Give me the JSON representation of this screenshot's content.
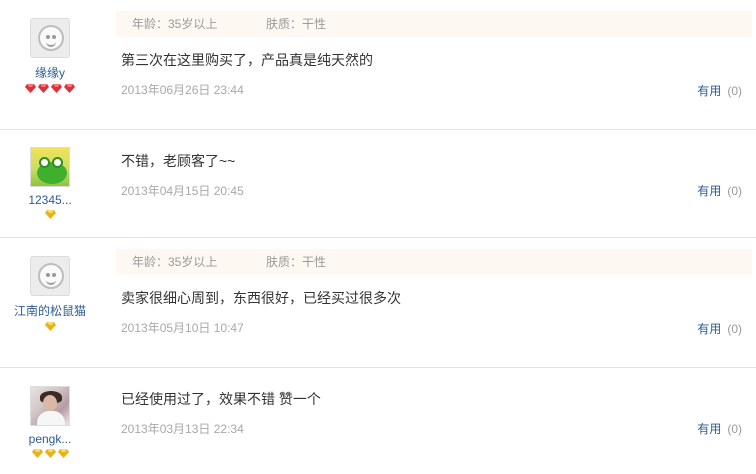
{
  "reviews": [
    {
      "username": "缘缘y",
      "avatar": "default-avatar",
      "rank": {
        "gem_count": 4,
        "gem_color": "#d8333a"
      },
      "meta": {
        "age": "年龄：35岁以上",
        "skin": "肤质：干性"
      },
      "content": "第三次在这里购买了，产品真是纯天然的",
      "date": "2013年06月26日 23:44",
      "useful_label": "有用",
      "useful_count": "(0)"
    },
    {
      "username": "12345...",
      "avatar": "frog-avatar",
      "rank": {
        "gem_count": 1,
        "gem_color": "#e8b21a"
      },
      "meta": null,
      "content": "不错，老顾客了~~",
      "date": "2013年04月15日 20:45",
      "useful_label": "有用",
      "useful_count": "(0)"
    },
    {
      "username": "江南的松鼠猫",
      "avatar": "default-avatar",
      "rank": {
        "gem_count": 1,
        "gem_color": "#e8b21a"
      },
      "meta": {
        "age": "年龄：35岁以上",
        "skin": "肤质：干性"
      },
      "content": "卖家很细心周到，东西很好，已经买过很多次",
      "date": "2013年05月10日 10:47",
      "useful_label": "有用",
      "useful_count": "(0)"
    },
    {
      "username": "pengk...",
      "avatar": "photo-avatar",
      "rank": {
        "gem_count": 3,
        "gem_color": "#e8b21a"
      },
      "meta": null,
      "content": "已经使用过了，效果不错 赞一个",
      "date": "2013年03月13日 22:34",
      "useful_label": "有用",
      "useful_count": "(0)"
    }
  ]
}
